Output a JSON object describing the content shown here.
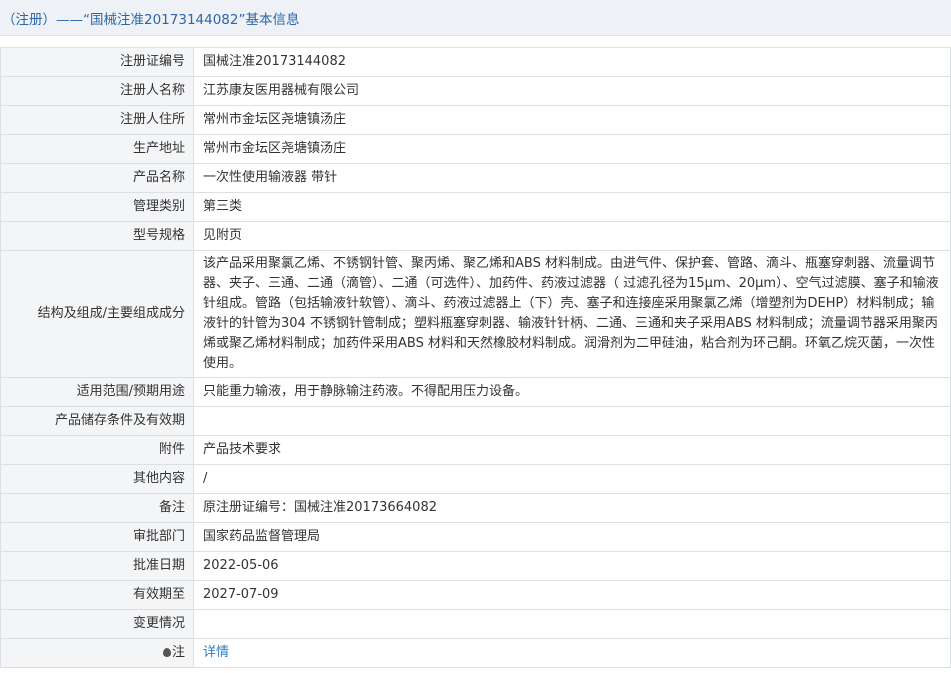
{
  "header": {
    "title": "（注册）——“国械注准20173144082”基本信息"
  },
  "rows": [
    {
      "label": "注册证编号",
      "value": "国械注准20173144082"
    },
    {
      "label": "注册人名称",
      "value": "江苏康友医用器械有限公司"
    },
    {
      "label": "注册人住所",
      "value": "常州市金坛区尧塘镇汤庄"
    },
    {
      "label": "生产地址",
      "value": "常州市金坛区尧塘镇汤庄"
    },
    {
      "label": "产品名称",
      "value": "一次性使用输液器 带针"
    },
    {
      "label": "管理类别",
      "value": "第三类"
    },
    {
      "label": "型号规格",
      "value": "见附页"
    },
    {
      "label": "结构及组成/主要组成成分",
      "value": "该产品采用聚氯乙烯、不锈钢针管、聚丙烯、聚乙烯和ABS 材料制成。由进气件、保护套、管路、滴斗、瓶塞穿刺器、流量调节器、夹子、三通、二通（滴管）、二通（可选件）、加药件、药液过滤器（ 过滤孔径为15μm、20μm）、空气过滤膜、塞子和输液针组成。管路（包括输液针软管）、滴斗、药液过滤器上（下）壳、塞子和连接座采用聚氯乙烯（增塑剂为DEHP）材料制成；输液针的针管为304 不锈钢针管制成；塑料瓶塞穿刺器、输液针针柄、二通、三通和夹子采用ABS 材料制成；流量调节器采用聚丙烯或聚乙烯材料制成；加药件采用ABS 材料和天然橡胶材料制成。润滑剂为二甲硅油，粘合剂为环己酮。环氧乙烷灭菌，一次性使用。"
    },
    {
      "label": "适用范围/预期用途",
      "value": "只能重力输液，用于静脉输注药液。不得配用压力设备。"
    },
    {
      "label": "产品储存条件及有效期",
      "value": ""
    },
    {
      "label": "附件",
      "value": "产品技术要求"
    },
    {
      "label": "其他内容",
      "value": "/"
    },
    {
      "label": "备注",
      "value": "原注册证编号：国械注准20173664082"
    },
    {
      "label": "审批部门",
      "value": "国家药品监督管理局"
    },
    {
      "label": "批准日期",
      "value": "2022-05-06"
    },
    {
      "label": "有效期至",
      "value": "2027-07-09"
    },
    {
      "label": "变更情况",
      "value": ""
    }
  ],
  "note_row": {
    "icon": "location-pin-icon",
    "label": "注",
    "link_text": "详情"
  },
  "colors": {
    "header_text": "#2b67a8",
    "link": "#2b7fc4",
    "label_bg": "#f4f5f7",
    "border": "#dcdfe6"
  }
}
